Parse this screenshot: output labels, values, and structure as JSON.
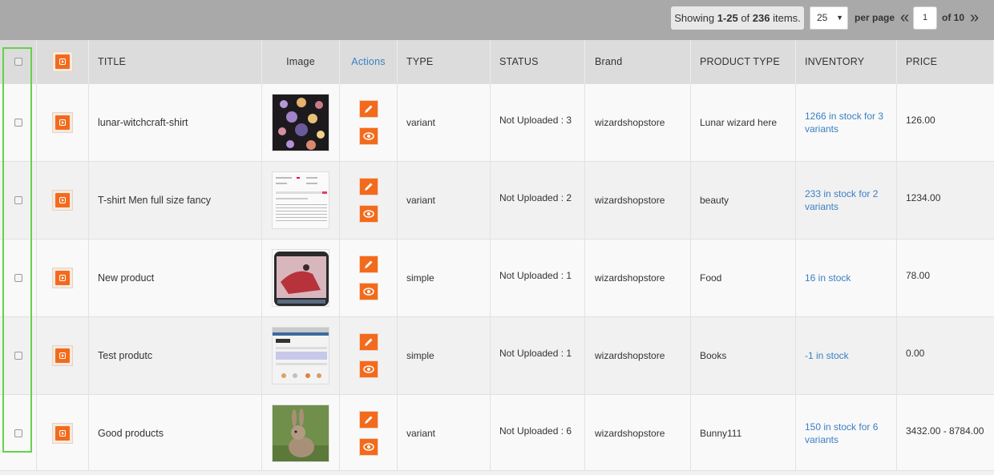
{
  "pagination": {
    "showing_prefix": "Showing ",
    "range": "1-25",
    "of_word": " of ",
    "total": "236",
    "items_word": " items.",
    "per_page_value": "25",
    "per_page_label": "per page",
    "prev": "«",
    "current_page": "1",
    "of_pages": "of 10",
    "next": "»"
  },
  "columns": {
    "title": "TITLE",
    "image": "Image",
    "actions": "Actions",
    "type": "TYPE",
    "status": "STATUS",
    "brand": "Brand",
    "product_type": "PRODUCT TYPE",
    "inventory": "INVENTORY",
    "price": "PRICE"
  },
  "rows": [
    {
      "title": "lunar-witchcraft-shirt",
      "type": "variant",
      "status": "Not Uploaded : 3",
      "brand": "wizardshopstore",
      "product_type": "Lunar wizard here",
      "inventory": "1266 in stock for 3 variants",
      "price": "126.00"
    },
    {
      "title": "T-shirt Men full size fancy",
      "type": "variant",
      "status": "Not Uploaded : 2",
      "brand": "wizardshopstore",
      "product_type": "beauty",
      "inventory": "233 in stock for 2 variants",
      "price": "1234.00"
    },
    {
      "title": "New product",
      "type": "simple",
      "status": "Not Uploaded : 1",
      "brand": "wizardshopstore",
      "product_type": "Food",
      "inventory": "16 in stock",
      "price": "78.00"
    },
    {
      "title": "Test produtc",
      "type": "simple",
      "status": "Not Uploaded : 1",
      "brand": "wizardshopstore",
      "product_type": "Books",
      "inventory": "-1 in stock",
      "price": "0.00"
    },
    {
      "title": "Good products",
      "type": "variant",
      "status": "Not Uploaded : 6",
      "brand": "wizardshopstore",
      "product_type": "Bunny111",
      "inventory": "150 in stock for 6 variants",
      "price": "3432.00 - 8784.00"
    }
  ],
  "colors": {
    "accent_orange": "#f26b1d",
    "link_blue": "#3b7fc4",
    "selection_green": "#66d14a"
  },
  "icons": {
    "row_icon": "product-link-icon",
    "edit": "pencil-icon",
    "view": "eye-icon"
  }
}
